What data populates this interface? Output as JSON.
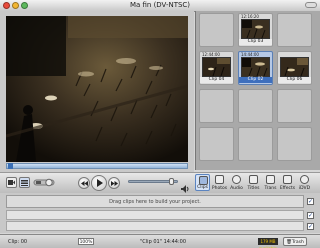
{
  "window": {
    "title": "Ma fin (DV-NTSC)"
  },
  "shelf": {
    "clips": [
      {
        "name": "Clip 03",
        "time": "12:16:20"
      },
      {
        "name": "Clip 04",
        "time": "12:44:00"
      },
      {
        "name": "Clip 02",
        "time": "14:44:00"
      },
      {
        "name": "Clip 06",
        "time": ""
      }
    ]
  },
  "tools": {
    "items": [
      {
        "label": "Clips"
      },
      {
        "label": "Photos"
      },
      {
        "label": "Audio"
      },
      {
        "label": "Titles"
      },
      {
        "label": "Trans"
      },
      {
        "label": "Effects"
      },
      {
        "label": "iDVD"
      }
    ]
  },
  "timeline": {
    "hint": "Drag clips here to build your project."
  },
  "status": {
    "clip_label": "Clip: 00",
    "zoom": "100%",
    "clip_info": "\"Clip 01\"  14:44:00",
    "free_space": "179 MB available",
    "trash_label": "Trash (0)"
  },
  "colors": {
    "selection": "#3e6fbd",
    "accent": "#5b84c0",
    "free_space_text": "#f0c200"
  },
  "icons": {
    "view_toggle": "camera-icon",
    "mode_switch": "mode-switch-icon",
    "rewind": "rewind-icon",
    "play": "play-icon",
    "fast_forward": "fast-forward-icon",
    "volume": "volume-icon",
    "trash": "trash-icon"
  }
}
